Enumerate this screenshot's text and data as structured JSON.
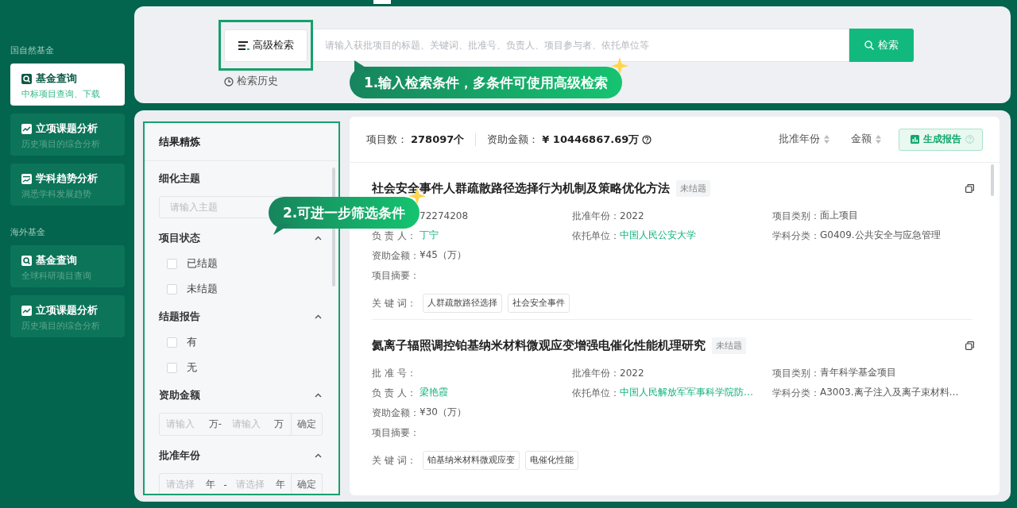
{
  "sidebar": {
    "sections": [
      {
        "heading": "国自然基金",
        "items": [
          {
            "title": "基金查询",
            "subtitle": "中标项目查询、下载",
            "selected": true
          },
          {
            "title": "立项课题分析",
            "subtitle": "历史项目的综合分析",
            "selected": false
          },
          {
            "title": "学科趋势分析",
            "subtitle": "洞悉学科发展趋势",
            "selected": false
          }
        ]
      },
      {
        "heading": "海外基金",
        "items": [
          {
            "title": "基金查询",
            "subtitle": "全球科研项目查询",
            "selected": false
          },
          {
            "title": "立项课题分析",
            "subtitle": "历史项目的综合分析",
            "selected": false
          }
        ]
      }
    ]
  },
  "search": {
    "advanced_button": "高级检索",
    "placeholder": "请输入获批项目的标题、关键词、批准号、负责人、项目参与者、依托单位等",
    "search_button": "检索",
    "history_link": "检索历史"
  },
  "callouts": [
    {
      "text": "1.输入检索条件，多条件可使用高级检索"
    },
    {
      "text": "2.可进一步筛选条件"
    }
  ],
  "filters": {
    "title": "结果精炼",
    "groups": [
      {
        "kind": "text",
        "title": "细化主题",
        "placeholder": "请输入主题"
      },
      {
        "kind": "checks",
        "title": "项目状态",
        "expanded": true,
        "options": [
          {
            "label": "已结题",
            "checked": false
          },
          {
            "label": "未结题",
            "checked": false
          }
        ]
      },
      {
        "kind": "checks",
        "title": "结题报告",
        "expanded": true,
        "options": [
          {
            "label": "有",
            "checked": false
          },
          {
            "label": "无",
            "checked": false
          }
        ]
      },
      {
        "kind": "range",
        "title": "资助金额",
        "expanded": true,
        "from_placeholder": "请输入",
        "from_unit": "万-",
        "to_placeholder": "请输入",
        "to_unit": "万",
        "confirm": "确定"
      },
      {
        "kind": "range",
        "title": "批准年份",
        "expanded": true,
        "from_placeholder": "请选择",
        "from_unit": "年",
        "separator": "-",
        "to_placeholder": "请选择",
        "to_unit": "年",
        "confirm": "确定"
      }
    ]
  },
  "summary": {
    "count_label": "项目数：",
    "count": "278097个",
    "amount_label": "资助金额：",
    "amount": "¥ 10446867.69万"
  },
  "sorts": [
    {
      "label": "批准年份"
    },
    {
      "label": "金额"
    }
  ],
  "report_button": "生成报告",
  "results": [
    {
      "title": "社会安全事件人群疏散路径选择行为机制及策略优化方法",
      "status": "未结题",
      "fields": [
        {
          "value": "72274208"
        },
        {
          "label": "批准年份：",
          "value": "2022"
        },
        {
          "label": "项目类别：",
          "value": "面上项目"
        },
        {
          "label": "负 责 人：",
          "value": "丁宁",
          "link": true
        },
        {
          "label": "依托单位：",
          "value": "中国人民公安大学",
          "link": true
        },
        {
          "label": "学科分类：",
          "value": "G0409.公共安全与应急管理"
        },
        {
          "label": "资助金额：",
          "value": "¥45（万）"
        },
        {
          "label": "项目摘要："
        }
      ],
      "keywords_label": "关 键 词：",
      "keywords": [
        "人群疏散路径选择",
        "社会安全事件"
      ]
    },
    {
      "title": "氦离子辐照调控铂基纳米材料微观应变增强电催化性能机理研究",
      "status": "未结题",
      "fields": [
        {
          "label": "批 准 号："
        },
        {
          "label": "批准年份：",
          "value": "2022"
        },
        {
          "label": "项目类别：",
          "value": "青年科学基金项目"
        },
        {
          "label": "负 责 人：",
          "value": "梁艳霞",
          "link": true
        },
        {
          "label": "依托单位：",
          "value": "中国人民解放军军事科学院防…",
          "link": true
        },
        {
          "label": "学科分类：",
          "value": "A3003.离子注入及离子束材料…"
        },
        {
          "label": "资助金额：",
          "value": "¥30（万）"
        },
        {
          "label": "项目摘要："
        }
      ],
      "keywords_label": "关 键 词：",
      "keywords": [
        "铂基纳米材料微观应变",
        "电催化性能"
      ]
    }
  ]
}
